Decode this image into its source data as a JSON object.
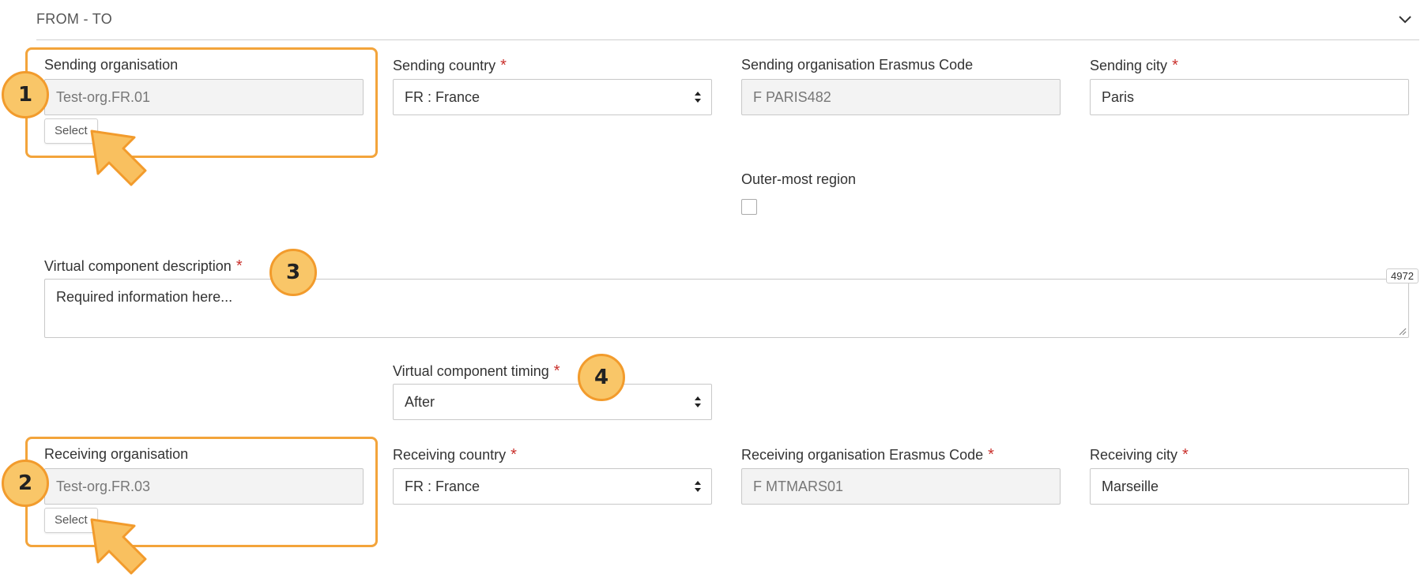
{
  "section": {
    "title": "FROM - TO",
    "collapse_icon": "chevron-down-icon"
  },
  "sending": {
    "organisation_label": "Sending organisation",
    "organisation_value": "Test-org.FR.01",
    "select_label": "Select",
    "country_label": "Sending country",
    "country_value": "FR : France",
    "erasmus_label": "Sending organisation Erasmus Code",
    "erasmus_value": "F  PARIS482",
    "city_label": "Sending city",
    "city_value": "Paris",
    "outer_region_label": "Outer-most region",
    "outer_region_checked": false
  },
  "virtual": {
    "description_label": "Virtual component description",
    "description_placeholder": "Required information here...",
    "char_counter": "4972",
    "timing_label": "Virtual component timing",
    "timing_value": "After"
  },
  "receiving": {
    "organisation_label": "Receiving organisation",
    "organisation_value": "Test-org.FR.03",
    "select_label": "Select",
    "country_label": "Receiving country",
    "country_value": "FR : France",
    "erasmus_label": "Receiving organisation Erasmus Code",
    "erasmus_value": "F  MTMARS01",
    "city_label": "Receiving city",
    "city_value": "Marseille"
  },
  "required_marker": "*",
  "annotations": {
    "badge_1": "1",
    "badge_2": "2",
    "badge_3": "3",
    "badge_4": "4",
    "highlight_color": "#f3a43b",
    "badge_fill": "#f9c668",
    "arrow_color": "#f9c05f",
    "required_color": "#c9302c"
  }
}
